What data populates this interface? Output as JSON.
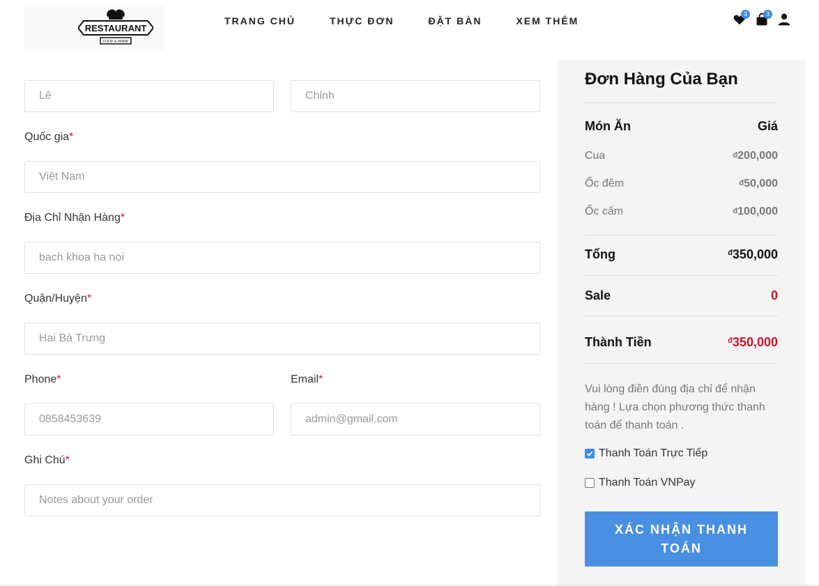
{
  "header": {
    "logo_text": "RESTAURANT",
    "logo_subtext": "FOOD & DRINK",
    "nav": [
      "TRANG CHỦ",
      "THỰC ĐƠN",
      "ĐẶT BÀN",
      "XEM THÊM"
    ],
    "wishlist_count": "3",
    "cart_count": "3",
    "icons": [
      "heart-icon",
      "shopping-bag-icon",
      "user-icon"
    ]
  },
  "form": {
    "last_name": {
      "value": "Lê"
    },
    "first_name": {
      "value": "Chỉnh"
    },
    "country": {
      "label": "Quốc gia",
      "value": "Việt Nam"
    },
    "address": {
      "label": "Địa Chỉ Nhận Hàng",
      "value": "bach khoa ha noi"
    },
    "district": {
      "label": "Quận/Huyện",
      "value": "Hai Bà Trưng"
    },
    "phone": {
      "label": "Phone",
      "value": "0858453639"
    },
    "email": {
      "label": "Email",
      "value": "admin@gmail.com"
    },
    "note": {
      "label": "Ghi Chú",
      "placeholder": "Notes about your order"
    },
    "required_mark": "*"
  },
  "order": {
    "title": "Đơn Hàng Của Bạn",
    "col_item": "Món Ăn",
    "col_price": "Giá",
    "currency": "đ",
    "items": [
      {
        "name": "Cua",
        "price": "200,000"
      },
      {
        "name": "Ốc đêm",
        "price": "50,000"
      },
      {
        "name": "Ốc cấm",
        "price": "100,000"
      }
    ],
    "total_label": "Tổng",
    "total_value": "350,000",
    "sale_label": "Sale",
    "sale_value": "0",
    "final_label": "Thành Tiền",
    "final_value": "350,000",
    "note": "Vui lòng điền đúng địa chỉ để nhận hàng ! Lựa chọn phương thức thanh toán để thanh toán .",
    "payment_options": [
      {
        "label": "Thanh Toán Trực Tiếp",
        "checked": true
      },
      {
        "label": "Thanh Toán VNPay",
        "checked": false
      }
    ],
    "submit_label": "XÁC NHẬN THANH TOÁN"
  },
  "colors": {
    "accent": "#4a90e2",
    "required": "#d0112b",
    "panel_bg": "#f4f4f4"
  }
}
